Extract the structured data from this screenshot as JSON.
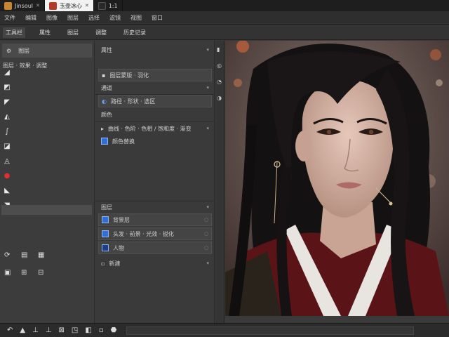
{
  "tabs": [
    {
      "label": "Jinsoul",
      "active": false,
      "thumb_color": "#c8862e"
    },
    {
      "label": "玉壶冰心",
      "active": true,
      "thumb_color": "#b33a2a"
    },
    {
      "label": "1:1",
      "active": false,
      "thumb_color": "#2a2a2a"
    }
  ],
  "menu": [
    "文件",
    "编辑",
    "图像",
    "图层",
    "选择",
    "滤镜",
    "视图",
    "窗口"
  ],
  "toolbar": [
    "工具栏",
    "属性",
    "图层",
    "调整",
    "历史记录"
  ],
  "left_panel": {
    "header": [
      "⚙",
      "图层"
    ],
    "sub": "图层 · 效果 · 调整"
  },
  "mid_panel": {
    "rows": [
      {
        "label": "属性",
        "boxed": false
      },
      {
        "label": "图层蒙版 · 羽化",
        "boxed": true
      },
      {
        "label": "通道",
        "boxed": false
      },
      {
        "label": "路径 · 形状 · 选区",
        "boxed": true
      },
      {
        "label": "颜色",
        "boxed": false
      },
      {
        "label": "曲线 · 色阶 · 色相 / 饱和度 · 渐变",
        "boxed": false
      },
      {
        "label": "颜色替换",
        "boxed": false
      },
      {
        "label": "图层",
        "boxed": false
      },
      {
        "label": "背景层",
        "boxed": true
      },
      {
        "label": "头发 · 前景 · 光效 · 锐化",
        "boxed": true
      },
      {
        "label": "人物",
        "boxed": true
      },
      {
        "label": "新建",
        "boxed": false
      }
    ]
  },
  "image": {
    "bg_color": "#5e4a44",
    "skin_color": "#d9b8a8",
    "hair_color": "#141112",
    "robe_color": "#5a1418",
    "collar_color": "#e8e4e0",
    "lip_color": "#b06a66",
    "bokeh_color": "#e06a3a"
  },
  "colors": {
    "accent_blue": "#2f6fd6",
    "tool_red": "#e03030"
  }
}
